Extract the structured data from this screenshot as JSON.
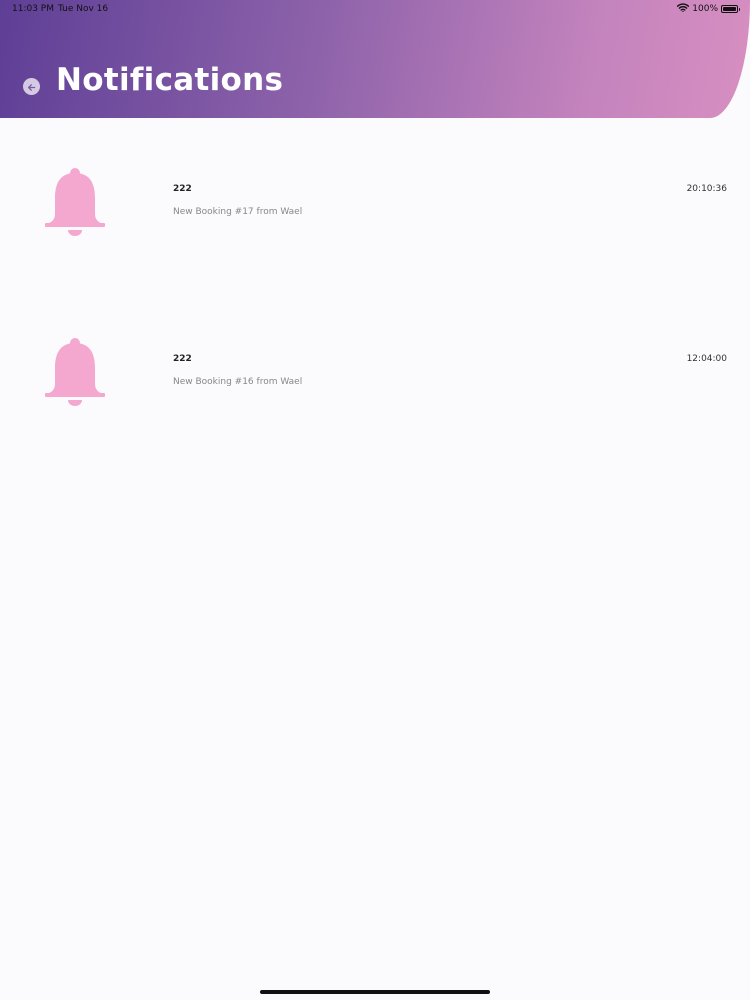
{
  "status_bar": {
    "time": "11:03 PM",
    "date": "Tue Nov 16",
    "battery_text": "100%",
    "battery_level": 1.0,
    "icons": [
      "wifi-icon",
      "battery-icon"
    ]
  },
  "header": {
    "title": "Notifications",
    "back_icon": "back-arrow-icon",
    "gradient_colors": [
      "#5e3f96",
      "#8d62aa",
      "#c383bd",
      "#d88fc1"
    ]
  },
  "notifications": [
    {
      "title": "222",
      "message": "New Booking #17 from Wael",
      "time": "20:10:36",
      "icon": "bell-icon"
    },
    {
      "title": "222",
      "message": "New Booking #16 from Wael",
      "time": "12:04:00",
      "icon": "bell-icon"
    }
  ],
  "colors": {
    "bell": "#f4a8cf",
    "background": "#fbfafc"
  }
}
